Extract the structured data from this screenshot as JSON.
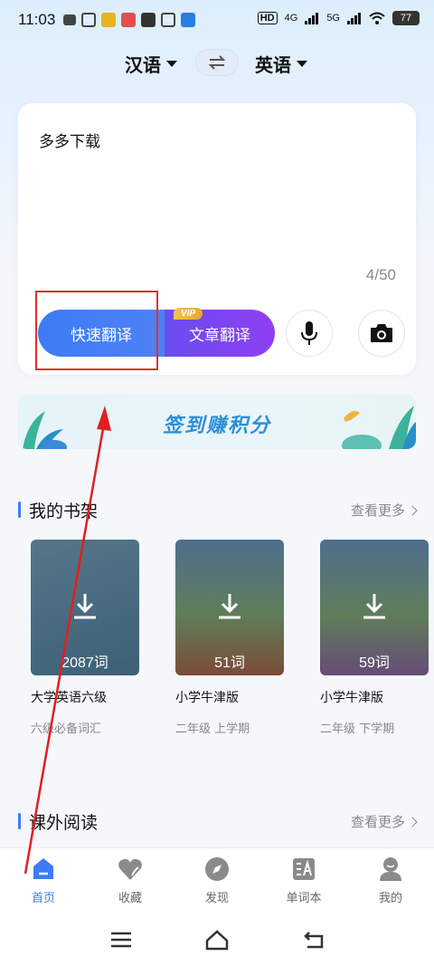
{
  "status_bar": {
    "time": "11:03",
    "network": "4G",
    "network2": "5G",
    "hd": "HD",
    "battery": "77"
  },
  "language_bar": {
    "source": "汉语",
    "target": "英语"
  },
  "translate_card": {
    "input_text": "多多下载",
    "char_count": "4/50",
    "quick_translate_label": "快速翻译",
    "article_translate_label": "文章翻译",
    "vip_label": "VIP"
  },
  "banner": {
    "text": "签到赚积分"
  },
  "bookshelf": {
    "title": "我的书架",
    "more": "查看更多",
    "books": [
      {
        "title": "大学英语六级",
        "subtitle": "六级必备词汇",
        "count": "2087词",
        "cover_color": "#6aa8c4"
      },
      {
        "title": "小学牛津版",
        "subtitle": "二年级 上学期",
        "count": "51词",
        "cover_color": "#4f9a4f"
      },
      {
        "title": "小学牛津版",
        "subtitle": "二年级 下学期",
        "count": "59词",
        "cover_color": "#4f9a4f"
      }
    ]
  },
  "reading": {
    "title": "课外阅读",
    "more": "查看更多"
  },
  "tabs": [
    {
      "label": "首页",
      "icon": "home-icon"
    },
    {
      "label": "收藏",
      "icon": "heart-icon"
    },
    {
      "label": "发现",
      "icon": "compass-icon"
    },
    {
      "label": "单词本",
      "icon": "wordbook-icon"
    },
    {
      "label": "我的",
      "icon": "profile-icon"
    }
  ],
  "colors": {
    "accent": "#3d7cf6",
    "article_btn": "#8f3ff2",
    "highlight": "#e03030"
  }
}
